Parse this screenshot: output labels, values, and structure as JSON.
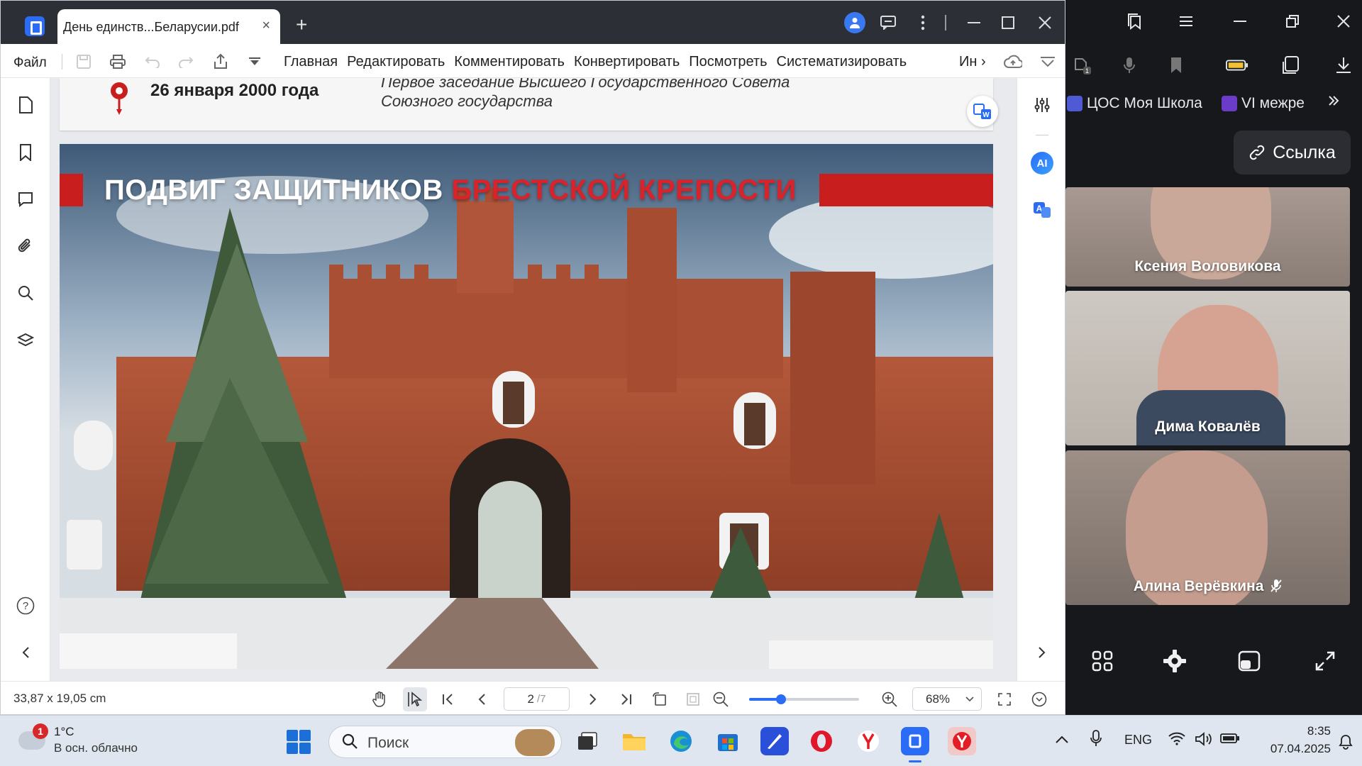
{
  "pdf_app": {
    "tab_title": "День единств...Беларусии.pdf",
    "tab_close": "×",
    "new_tab": "+",
    "menu": {
      "file": "Файл",
      "tabs": [
        "Главная",
        "Редактировать",
        "Комментировать",
        "Конвертировать",
        "Посмотреть",
        "Систематизировать"
      ],
      "more": "Ин ›"
    },
    "right_tools": {
      "ai_label": "AI"
    },
    "document": {
      "event_date": "26 января 2000 года",
      "event_desc": "Первое заседание Высшего Государственного Совета\nСоюзного государства",
      "slide_title_white": "ПОДВИГ ЗАЩИТНИКОВ",
      "slide_title_red": "БРЕСТСКОЙ КРЕПОСТИ"
    },
    "status": {
      "page_size": "33,87 x 19,05 cm",
      "page_current": "2",
      "page_total": "/7",
      "zoom": "68%",
      "zoom_level_fraction": 0.29
    }
  },
  "meeting": {
    "bookmarks": [
      {
        "label": "ЦОС Моя Школа",
        "color": "#6a3cc8"
      },
      {
        "label": "VI межре",
        "color": "#5b3fd0"
      }
    ],
    "link_button": "Ссылка",
    "participants": [
      {
        "name": "Ксения Воловикова",
        "muted": false
      },
      {
        "name": "Дима Ковалёв",
        "muted": false
      },
      {
        "name": "Алина Верёвкина",
        "muted": true
      }
    ]
  },
  "taskbar": {
    "weather_badge": "1",
    "weather_temp": "1°C",
    "weather_desc": "В осн. облачно",
    "search_placeholder": "Поиск",
    "language": "ENG",
    "time": "8:35",
    "date": "07.04.2025"
  },
  "colors": {
    "brand_blue": "#2b6cf6",
    "slide_red": "#c81e1e",
    "title_bar": "#2d2f36",
    "meeting_bg": "#16181c",
    "taskbar": "#dfe6f0"
  }
}
